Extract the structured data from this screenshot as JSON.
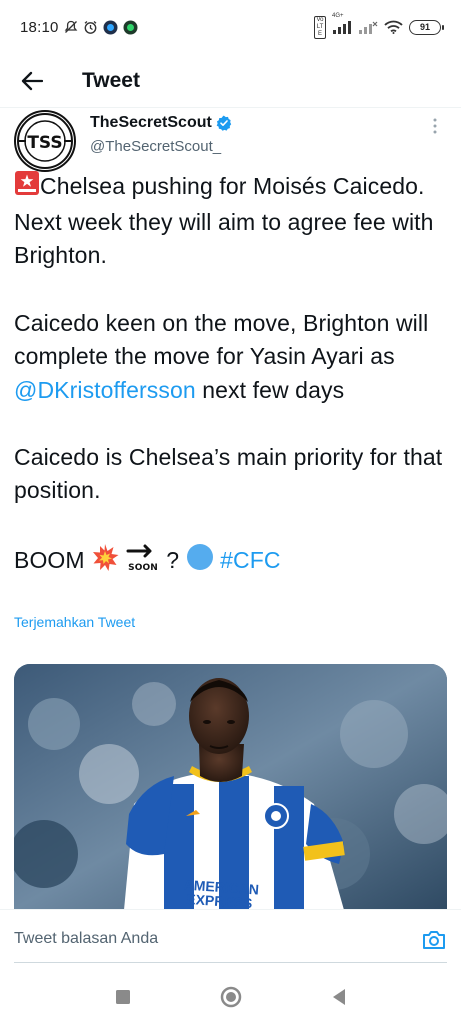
{
  "status_bar": {
    "time": "18:10",
    "battery": "91",
    "network": "4G+",
    "volte": "Vo LTE"
  },
  "header": {
    "title": "Tweet"
  },
  "author": {
    "display_name": "TheSecretScout",
    "handle": "@TheSecretScout_",
    "verified": true,
    "avatar_text": "TSS"
  },
  "tweet": {
    "line1_pre": "Chelsea pushing for Moisés Caicedo. Next week they will aim to agree fee with Brighton.",
    "para2_pre": "Caicedo keen on the move, Brighton will complete the move for Yasin Ayari as ",
    "para2_mention": "@DKristoffersson",
    "para2_post": " next few days",
    "para3": "Caicedo is Chelsea’s main priority for that position.",
    "para4_boom": "BOOM",
    "para4_question": "?",
    "para4_hashtag": "#CFC",
    "soon_label": "SOON",
    "translate_label": "Terjemahkan Tweet"
  },
  "photo": {
    "sponsor_line1": "AMERICAN",
    "sponsor_line2": "EXPRESS"
  },
  "reply": {
    "placeholder": "Tweet balasan Anda"
  },
  "colors": {
    "link": "#1d9bf0",
    "text": "#0f1419",
    "secondary": "#536471"
  }
}
